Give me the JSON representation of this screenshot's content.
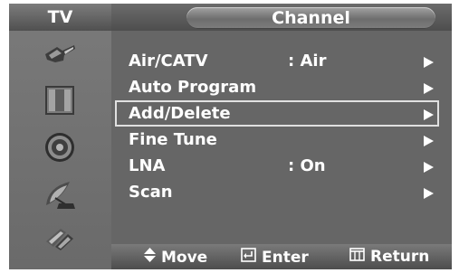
{
  "sidebar": {
    "title": "TV",
    "icons": [
      "input-plug-icon",
      "picture-panel-icon",
      "speaker-icon",
      "satellite-dish-icon",
      "plug-setup-icon"
    ]
  },
  "header": {
    "title": "Channel"
  },
  "menu": [
    {
      "label": "Air/CATV",
      "value": ":  Air",
      "arrow": "▶"
    },
    {
      "label": "Auto Program",
      "value": "",
      "arrow": "▶"
    },
    {
      "label": "Add/Delete",
      "value": "",
      "arrow": "▶",
      "selected": true
    },
    {
      "label": "Fine Tune",
      "value": "",
      "arrow": "▶"
    },
    {
      "label": "LNA",
      "value": ":  On",
      "arrow": "▶"
    },
    {
      "label": "Scan",
      "value": "",
      "arrow": "▶"
    }
  ],
  "footer": {
    "move": "Move",
    "enter": "Enter",
    "return": "Return"
  }
}
